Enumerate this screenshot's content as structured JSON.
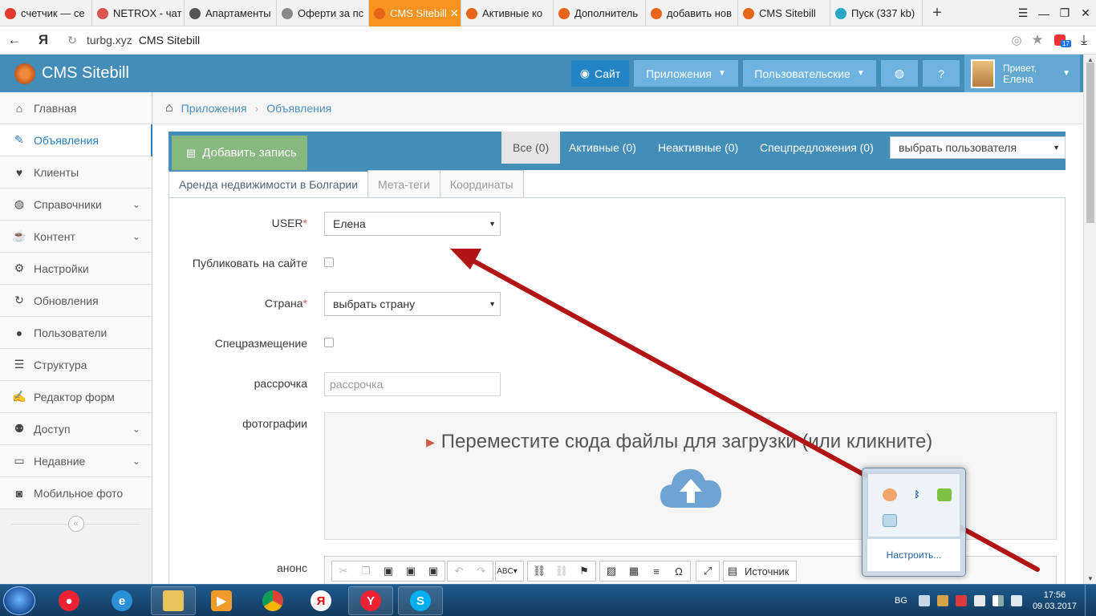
{
  "browser": {
    "tabs": [
      {
        "label": "счетчик — се",
        "fav": "#e23c2f",
        "active": false
      },
      {
        "label": "NETROX - чат",
        "fav": "#d9534f",
        "active": false
      },
      {
        "label": "Апартаменты",
        "fav": "#555555",
        "active": false
      },
      {
        "label": "Оферти за пс",
        "fav": "#888888",
        "active": false
      },
      {
        "label": "CMS Sitebill",
        "fav": "#e8641b",
        "active": true
      },
      {
        "label": "Активные ко",
        "fav": "#e8641b",
        "active": false
      },
      {
        "label": "Дополнитель",
        "fav": "#e8641b",
        "active": false
      },
      {
        "label": "добавить нов",
        "fav": "#e8641b",
        "active": false
      },
      {
        "label": "CMS Sitebill",
        "fav": "#e8641b",
        "active": false
      },
      {
        "label": "Пуск (337 kb)",
        "fav": "#2aa6c7",
        "active": false
      }
    ],
    "address_host": "turbg.xyz",
    "address_title": "CMS Sitebill",
    "yandex_mark": "Я",
    "badge_count": "17"
  },
  "header": {
    "brand": "CMS Sitebill",
    "site_label": "Сайт",
    "apps_label": "Приложения",
    "users_label": "Пользовательские",
    "greeting": "Привет,",
    "user_name": "Елена"
  },
  "sidebar": {
    "items": [
      {
        "label": "Главная",
        "icon": "home-icon",
        "glyph": "⌂",
        "chevron": false,
        "active": false
      },
      {
        "label": "Объявления",
        "icon": "pencil-icon",
        "glyph": "✎",
        "chevron": false,
        "active": true
      },
      {
        "label": "Клиенты",
        "icon": "heart-icon",
        "glyph": "♥",
        "chevron": false,
        "active": false
      },
      {
        "label": "Справочники",
        "icon": "globe-icon",
        "glyph": "◍",
        "chevron": true,
        "active": false
      },
      {
        "label": "Контент",
        "icon": "coffee-icon",
        "glyph": "☕",
        "chevron": true,
        "active": false
      },
      {
        "label": "Настройки",
        "icon": "gear-icon",
        "glyph": "⚙",
        "chevron": false,
        "active": false
      },
      {
        "label": "Обновления",
        "icon": "refresh-icon",
        "glyph": "↻",
        "chevron": false,
        "active": false
      },
      {
        "label": "Пользователи",
        "icon": "user-icon",
        "glyph": "●",
        "chevron": false,
        "active": false
      },
      {
        "label": "Структура",
        "icon": "list-icon",
        "glyph": "☰",
        "chevron": false,
        "active": false
      },
      {
        "label": "Редактор форм",
        "icon": "edit-icon",
        "glyph": "✍",
        "chevron": false,
        "active": false
      },
      {
        "label": "Доступ",
        "icon": "users-icon",
        "glyph": "⚉",
        "chevron": true,
        "active": false
      },
      {
        "label": "Недавние",
        "icon": "monitor-icon",
        "glyph": "▭",
        "chevron": true,
        "active": false
      },
      {
        "label": "Мобильное фото",
        "icon": "camera-icon",
        "glyph": "◙",
        "chevron": false,
        "active": false
      }
    ]
  },
  "breadcrumb": {
    "items": [
      "Приложения",
      "Объявления"
    ]
  },
  "toolbar": {
    "add_label": "Добавить запись",
    "filters": [
      "Все (0)",
      "Активные (0)",
      "Неактивные (0)",
      "Спецпредложения (0)"
    ],
    "user_select": "выбрать пользователя"
  },
  "form": {
    "tabs": [
      "Аренда недвижимости в Болгарии",
      "Мета-теги",
      "Координаты"
    ],
    "user_label": "USER",
    "user_value": "Елена",
    "publish_label": "Публиковать на сайте",
    "country_label": "Страна",
    "country_value": "выбрать страну",
    "special_label": "Спецразмещение",
    "installment_label": "рассрочка",
    "installment_placeholder": "рассрочка",
    "photos_label": "фотографии",
    "dropzone_text": "Переместите сюда файлы для загрузки (или кликните)",
    "announce_label": "анонс",
    "editor_source": "Источник"
  },
  "tray_popup": {
    "configure": "Настроить..."
  },
  "taskbar": {
    "lang": "BG",
    "time": "17:56",
    "date": "09.03.2017"
  },
  "colors": {
    "header": "#438eb9",
    "accent": "#2b7dbc",
    "add_button": "#87b87f",
    "arrow": "#b01414"
  }
}
